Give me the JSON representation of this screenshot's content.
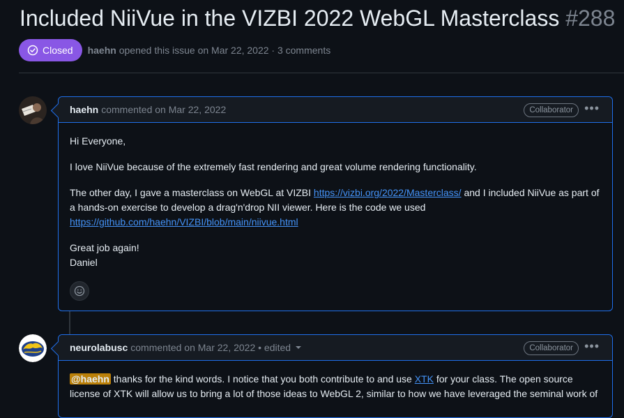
{
  "issue": {
    "title": "Included NiiVue in the VIZBI 2022 WebGL Masterclass",
    "number": "#288",
    "state": "Closed",
    "author": "haehn",
    "opened_text": "opened this issue on Mar 22, 2022 · 3 comments"
  },
  "comments": [
    {
      "author": "haehn",
      "meta": "commented on Mar 22, 2022",
      "badge": "Collaborator",
      "p1": "Hi Everyone,",
      "p2": "I love NiiVue because of the extremely fast rendering and great volume rendering functionality.",
      "p3_a": "The other day, I gave a masterclass on WebGL at VIZBI ",
      "p3_link": "https://vizbi.org/2022/Masterclass/",
      "p3_b": " and I included NiiVue as part of a hands-on exercise to develop a drag'n'drop NII viewer. Here is the code we used ",
      "p3_link2": "https://github.com/haehn/VIZBI/blob/main/niivue.html",
      "p4_line1": "Great job again!",
      "p4_line2": "Daniel"
    },
    {
      "author": "neurolabusc",
      "meta": "commented on Mar 22, 2022 • edited",
      "badge": "Collaborator",
      "mention": "@haehn",
      "text_a": " thanks for the kind words. I notice that you both contribute to and use ",
      "link": "XTK",
      "text_b": " for your class. The open source license of XTK will allow us to bring a lot of those ideas to WebGL 2, similar to how we have leveraged the seminal work of"
    }
  ],
  "icons": {
    "state": "check-circle-icon",
    "more": "kebab-horizontal-icon",
    "reaction": "smiley-icon"
  },
  "colors": {
    "closed_badge": "#8957e5",
    "link": "#4493f8",
    "border_active": "#1f6feb",
    "mention_bg": "#bb8009"
  }
}
